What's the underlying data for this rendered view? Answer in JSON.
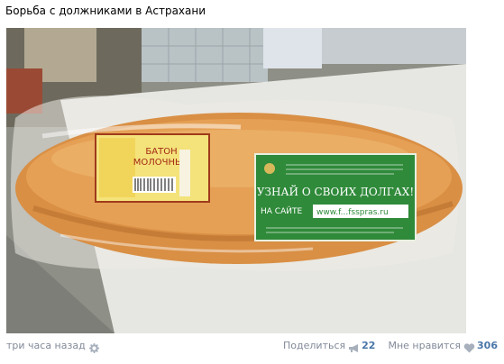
{
  "post": {
    "title": "Борьба с должниками в Астрахани"
  },
  "photo": {
    "price_tag": {
      "line1": "БАТОН",
      "line2": "МОЛОЧНЫЙ"
    },
    "green_label": {
      "headline": "УЗНАЙ О СВОИХ ДОЛГАХ!",
      "site_prefix": "НА САЙТЕ",
      "site_url": "www.f...fsspras.ru"
    }
  },
  "footer": {
    "time": "три часа назад",
    "share_label": "Поделиться",
    "share_count": "22",
    "like_label": "Мне нравится",
    "like_count": "306"
  },
  "colors": {
    "link_blue": "#4a76a8",
    "muted_text": "#828a99",
    "label_green": "#2f8a3a"
  }
}
